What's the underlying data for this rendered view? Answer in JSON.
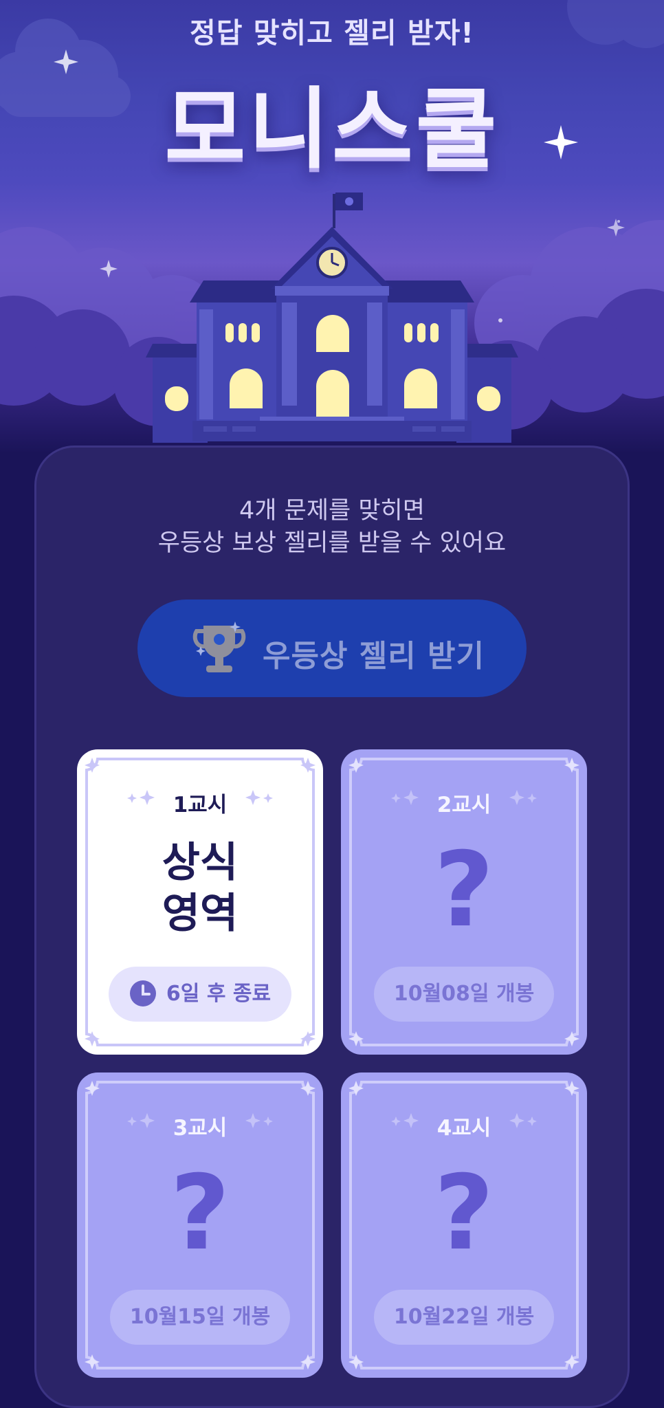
{
  "header": {
    "subtitle": "정답 맞히고 젤리 받자!",
    "title": "모니스쿨"
  },
  "intro": {
    "line1": "4개 문제를 맞히면",
    "line2": "우등상 보상 젤리를 받을 수 있어요"
  },
  "reward_button": {
    "label": "우등상 젤리 받기",
    "icon": "trophy-icon"
  },
  "cards": [
    {
      "period": "1교시",
      "subject_line1": "상식",
      "subject_line2": "영역",
      "status": "6일 후 종료",
      "state": "active"
    },
    {
      "period": "2교시",
      "mark": "?",
      "status": "10월08일 개봉",
      "state": "locked"
    },
    {
      "period": "3교시",
      "mark": "?",
      "status": "10월15일 개봉",
      "state": "locked"
    },
    {
      "period": "4교시",
      "mark": "?",
      "status": "10월22일 개봉",
      "state": "locked"
    }
  ],
  "colors": {
    "background": "#1a1458",
    "panel": "#2b2468",
    "button": "#1e3fae",
    "card_active": "#ffffff",
    "card_locked": "#a4a2f4",
    "text_dark": "#1e1b56"
  }
}
